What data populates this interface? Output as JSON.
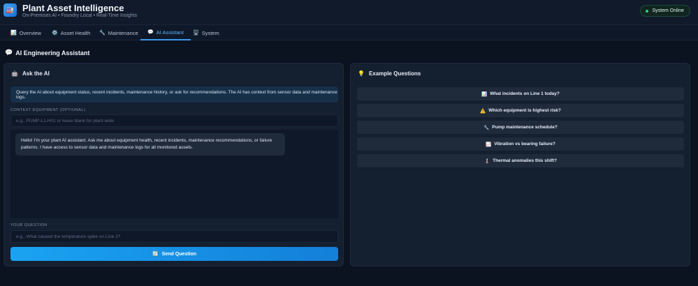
{
  "header": {
    "logo_icon": "🏭",
    "title": "Plant Asset Intelligence",
    "subtitle": "On-Premises AI • Foundry Local • Real-Time Insights",
    "status": "System Online",
    "status_color": "#2bd38b"
  },
  "tabs": [
    {
      "icon": "📊",
      "label": "Overview"
    },
    {
      "icon": "⚙️",
      "label": "Asset Health"
    },
    {
      "icon": "🔧",
      "label": "Maintenance"
    },
    {
      "icon": "💬",
      "label": "AI Assistant"
    },
    {
      "icon": "🖥️",
      "label": "System"
    }
  ],
  "active_tab": "AI Assistant",
  "section": {
    "icon": "💬",
    "title": "AI Engineering Assistant"
  },
  "ask": {
    "icon": "🤖",
    "title": "Ask the AI",
    "info": "Query the AI about equipment status, recent incidents, maintenance history, or ask for recommendations. The AI has context from sensor data and maintenance logs.",
    "context_label": "CONTEXT EQUIPMENT (OPTIONAL)",
    "context_placeholder": "e.g., PUMP-L1-H01 or leave blank for plant-wide",
    "greeting": "Hello! I'm your plant AI assistant. Ask me about equipment health, recent incidents, maintenance recommendations, or failure patterns. I have access to sensor data and maintenance logs for all monitored assets.",
    "question_label": "YOUR QUESTION",
    "question_placeholder": "e.g., What caused the temperature spike on Line 2?",
    "send_icon": "🔄",
    "send_label": "Send Question"
  },
  "examples": {
    "icon": "💡",
    "title": "Example Questions",
    "items": [
      {
        "icon": "📊",
        "label": "What incidents on Line 1 today?"
      },
      {
        "icon": "⚠️",
        "label": "Which equipment is highest risk?"
      },
      {
        "icon": "🔧",
        "label": "Pump maintenance schedule?"
      },
      {
        "icon": "📈",
        "label": "Vibration vs bearing failure?"
      },
      {
        "icon": "🌡️",
        "label": "Thermal anomalies this shift?"
      }
    ]
  },
  "accent_color": "#3a9bf0"
}
